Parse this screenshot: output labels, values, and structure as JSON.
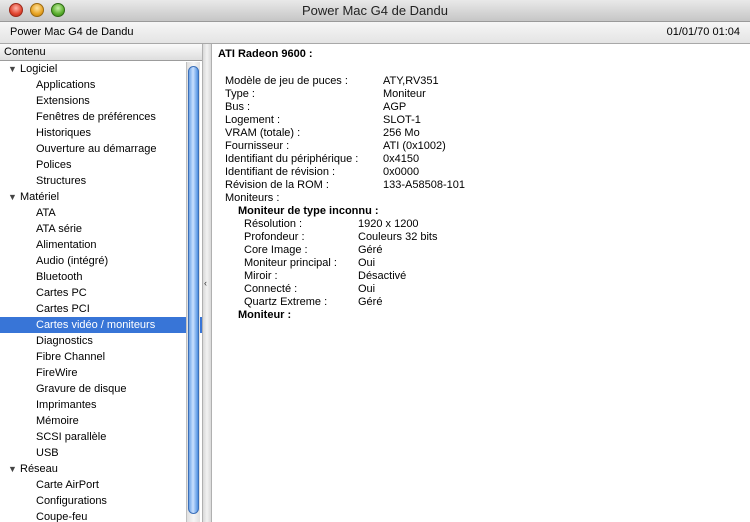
{
  "window": {
    "title": "Power Mac G4 de Dandu"
  },
  "header": {
    "machine_name": "Power Mac G4 de Dandu",
    "timestamp": "01/01/70 01:04"
  },
  "sidebar": {
    "column_header": "Contenu",
    "groups": [
      {
        "label": "Logiciel",
        "items": [
          "Applications",
          "Extensions",
          "Fenêtres de préférences",
          "Historiques",
          "Ouverture au démarrage",
          "Polices",
          "Structures"
        ]
      },
      {
        "label": "Matériel",
        "items": [
          "ATA",
          "ATA série",
          "Alimentation",
          "Audio (intégré)",
          "Bluetooth",
          "Cartes PC",
          "Cartes PCI",
          "Cartes vidéo / moniteurs",
          "Diagnostics",
          "Fibre Channel",
          "FireWire",
          "Gravure de disque",
          "Imprimantes",
          "Mémoire",
          "SCSI parallèle",
          "USB"
        ]
      },
      {
        "label": "Réseau",
        "items": [
          "Carte AirPort",
          "Configurations",
          "Coupe-feu"
        ]
      }
    ],
    "selected": "Cartes vidéo / moniteurs"
  },
  "detail": {
    "title": "ATI Radeon 9600 :",
    "properties": [
      {
        "key": "Modèle de jeu de puces :",
        "value": "ATY,RV351"
      },
      {
        "key": "Type :",
        "value": "Moniteur"
      },
      {
        "key": "Bus :",
        "value": "AGP"
      },
      {
        "key": "Logement :",
        "value": "SLOT-1"
      },
      {
        "key": "VRAM (totale) :",
        "value": "256 Mo"
      },
      {
        "key": "Fournisseur :",
        "value": "ATI (0x1002)"
      },
      {
        "key": "Identifiant du périphérique :",
        "value": "0x4150"
      },
      {
        "key": "Identifiant de révision :",
        "value": "0x0000"
      },
      {
        "key": "Révision de la ROM :",
        "value": "133-A58508-101"
      },
      {
        "key": "Moniteurs :",
        "value": ""
      }
    ],
    "monitor1": {
      "title": "Moniteur de type inconnu :",
      "properties": [
        {
          "key": "Résolution :",
          "value": "1920 x 1200"
        },
        {
          "key": "Profondeur :",
          "value": "Couleurs 32 bits"
        },
        {
          "key": "Core Image :",
          "value": "Géré"
        },
        {
          "key": "Moniteur principal :",
          "value": "Oui"
        },
        {
          "key": "Miroir :",
          "value": "Désactivé"
        },
        {
          "key": "Connecté :",
          "value": "Oui"
        },
        {
          "key": "Quartz Extreme :",
          "value": "Géré"
        }
      ]
    },
    "monitor2": {
      "title": "Moniteur :"
    }
  }
}
